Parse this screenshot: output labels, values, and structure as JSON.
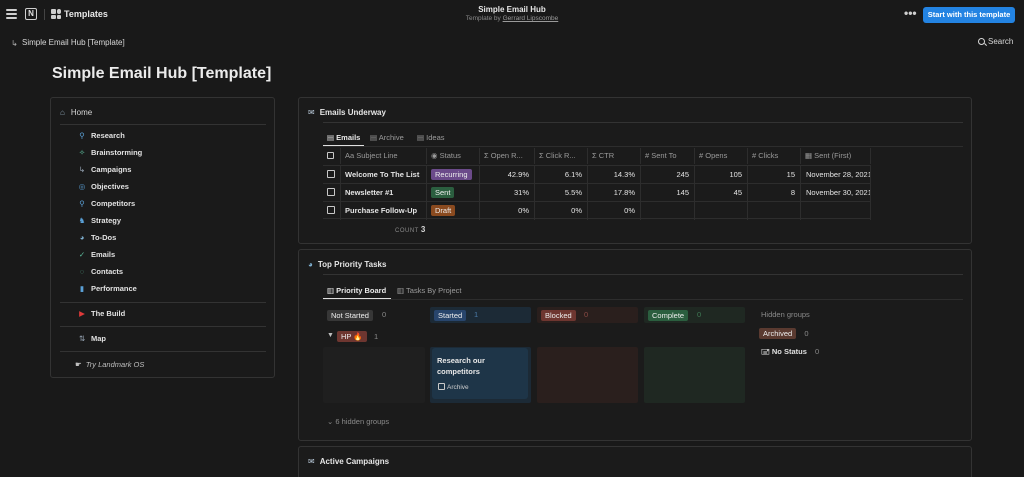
{
  "topbar": {
    "templates_label": "Templates",
    "title": "Simple Email Hub",
    "subtitle_prefix": "Template by",
    "author": "Gerrard Lipscombe",
    "more": "•••",
    "cta": "Start with this template"
  },
  "breadcrumb": "Simple Email Hub [Template]",
  "search_label": "Search",
  "page_title": "Simple Email Hub [Template]",
  "sidebar": {
    "home": "Home",
    "group1": [
      "Research",
      "Brainstorming",
      "Campaigns",
      "Objectives",
      "Competitors",
      "Strategy",
      "To-Dos",
      "Emails",
      "Contacts",
      "Performance"
    ],
    "the_build": "The Build",
    "map": "Map",
    "try": "Try Landmark OS"
  },
  "emails": {
    "title": "Emails Underway",
    "tabs": [
      "Emails",
      "Archive",
      "Ideas"
    ],
    "columns": [
      "Aa Subject Line",
      "Status",
      "Σ Open R...",
      "Σ Click R...",
      "Σ CTR",
      "# Sent To",
      "# Opens",
      "# Clicks",
      "Sent (First)"
    ],
    "rows": [
      {
        "subject": "Welcome To The List",
        "status": "Recurring",
        "open": "42.9%",
        "click": "6.1%",
        "ctr": "14.3%",
        "sent_to": "245",
        "opens": "105",
        "clicks": "15",
        "sent_first": "November 28, 2021"
      },
      {
        "subject": "Newsletter #1",
        "status": "Sent",
        "open": "31%",
        "click": "5.5%",
        "ctr": "17.8%",
        "sent_to": "145",
        "opens": "45",
        "clicks": "8",
        "sent_first": "November 30, 2021"
      },
      {
        "subject": "Purchase Follow-Up",
        "status": "Draft",
        "open": "0%",
        "click": "0%",
        "ctr": "0%",
        "sent_to": "",
        "opens": "",
        "clicks": "",
        "sent_first": ""
      }
    ],
    "count_label": "COUNT",
    "count_value": "3"
  },
  "tasks": {
    "title": "Top Priority Tasks",
    "tabs": [
      "Priority Board",
      "Tasks By Project"
    ],
    "columns": [
      {
        "label": "Not Started",
        "count": "0"
      },
      {
        "label": "Started",
        "count": "1"
      },
      {
        "label": "Blocked",
        "count": "0"
      },
      {
        "label": "Complete",
        "count": "0"
      }
    ],
    "hidden_groups_label": "Hidden groups",
    "hidden": [
      {
        "label": "Archived",
        "count": "0"
      },
      {
        "label": "No Status",
        "count": "0"
      }
    ],
    "group_label": "HP 🔥",
    "group_count": "1",
    "card_title": "Research our competitors",
    "card_property": "Archive",
    "hidden_groups_toggle": "6 hidden groups"
  },
  "campaigns": {
    "title": "Active Campaigns"
  },
  "colors": {
    "accent": "#2383e2",
    "recurring": "#6b4a8a",
    "sent": "#2b5e3f",
    "draft": "#8a4a1f",
    "started": "#28456c",
    "blocked": "#6e3630",
    "complete": "#2b5e3f",
    "not_started": "#373737"
  }
}
